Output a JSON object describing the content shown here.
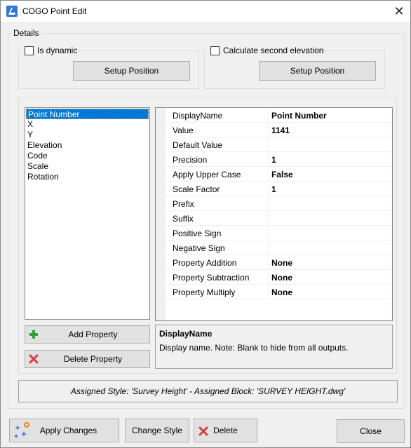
{
  "window": {
    "title": "COGO Point Edit",
    "close_glyph": "✕"
  },
  "details": {
    "legend": "Details",
    "is_dynamic": {
      "label": "Is dynamic",
      "checked": false
    },
    "setup_position_1": "Setup Position",
    "calc_second_elevation": {
      "label": "Calculate second elevation",
      "checked": false
    },
    "setup_position_2": "Setup Position"
  },
  "property_list": {
    "items": [
      {
        "label": "Point Number",
        "selected": true
      },
      {
        "label": "X"
      },
      {
        "label": "Y"
      },
      {
        "label": "Elevation"
      },
      {
        "label": "Code"
      },
      {
        "label": "Scale"
      },
      {
        "label": "Rotation"
      }
    ]
  },
  "property_grid": {
    "rows": [
      {
        "name": "DisplayName",
        "value": "Point Number"
      },
      {
        "name": "Value",
        "value": "1141"
      },
      {
        "name": "Default Value",
        "value": ""
      },
      {
        "name": "Precision",
        "value": "1"
      },
      {
        "name": "Apply Upper Case",
        "value": "False"
      },
      {
        "name": "Scale Factor",
        "value": "1"
      },
      {
        "name": "Prefix",
        "value": ""
      },
      {
        "name": "Suffix",
        "value": ""
      },
      {
        "name": "Positive Sign",
        "value": ""
      },
      {
        "name": "Negative Sign",
        "value": ""
      },
      {
        "name": "Property Addition",
        "value": "None"
      },
      {
        "name": "Property Subtraction",
        "value": "None"
      },
      {
        "name": "Property Multiply",
        "value": "None"
      }
    ]
  },
  "description": {
    "title": "DisplayName",
    "text": "Display name. Note: Blank to hide from all outputs."
  },
  "buttons": {
    "add_property": "Add Property",
    "delete_property": "Delete Property",
    "apply_changes": "Apply Changes",
    "change_style": "Change Style",
    "delete": "Delete",
    "close": "Close"
  },
  "status": {
    "text": "Assigned Style: 'Survey Height' - Assigned Block: 'SURVEY HEIGHT.dwg'"
  },
  "colors": {
    "selection": "#0078d7",
    "add_icon": "#2e9e3e",
    "delete_icon": "#d04040",
    "app_icon": "#2c7ad6"
  },
  "icons": {
    "app": "app-logo-icon",
    "add": "plus-icon",
    "delete": "x-icon",
    "apply": "sparkle-icon"
  }
}
